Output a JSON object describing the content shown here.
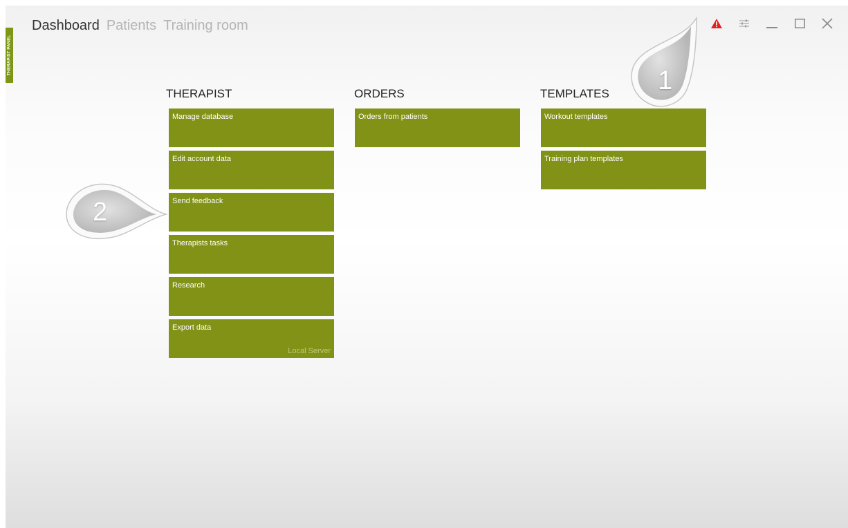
{
  "sidebar": {
    "label": "THERAPIST PANEL"
  },
  "nav": {
    "tabs": [
      {
        "label": "Dashboard",
        "active": true
      },
      {
        "label": "Patients",
        "active": false
      },
      {
        "label": "Training room",
        "active": false
      }
    ]
  },
  "window_controls": [
    "warning-icon",
    "settings-sliders-icon",
    "minimize-icon",
    "maximize-icon",
    "close-icon"
  ],
  "sections": {
    "therapist": {
      "title": "THERAPIST",
      "tiles": [
        "Manage database",
        "Edit account data",
        "Send feedback",
        "Therapists tasks",
        "Research",
        "Export data"
      ],
      "export_sublabel": "Local Server"
    },
    "orders": {
      "title": "ORDERS",
      "tiles": [
        "Orders from patients"
      ]
    },
    "templates": {
      "title": "TEMPLATES",
      "tiles": [
        "Workout templates",
        "Training plan templates"
      ]
    }
  },
  "callouts": [
    "1",
    "2"
  ],
  "colors": {
    "tile": "#829216",
    "side_tab": "#7e9615",
    "warning": "#e52020",
    "nav_active": "#333333",
    "nav_inactive": "#b4b4b4"
  }
}
